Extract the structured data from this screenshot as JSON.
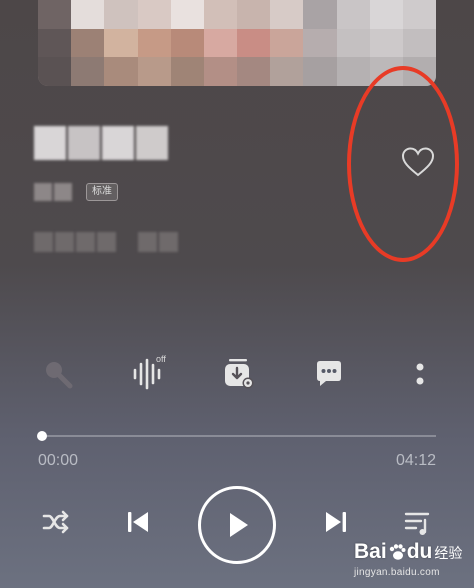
{
  "song": {
    "quality_badge": "标准"
  },
  "effects": {
    "off_label": "off"
  },
  "progress": {
    "current": "00:00",
    "total": "04:12",
    "fraction": 0.0
  },
  "icons": {
    "like": "heart-outline-icon",
    "karaoke": "microphone-icon",
    "sound_effect": "soundwave-icon",
    "download": "download-icon",
    "comments": "comment-icon",
    "more": "more-vertical-icon",
    "shuffle": "shuffle-icon",
    "previous": "skip-previous-icon",
    "play": "play-icon",
    "next": "skip-next-icon",
    "playlist": "playlist-icon"
  },
  "annotation": {
    "color": "#e83b26"
  },
  "watermark": {
    "brand": "Bai",
    "brand2": "du",
    "suffix": "经验",
    "url": "jingyan.baidu.com"
  }
}
